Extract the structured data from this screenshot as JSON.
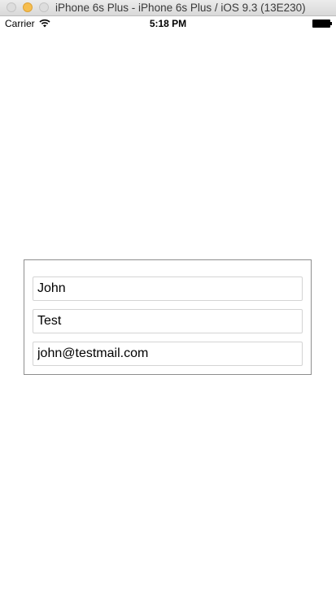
{
  "window": {
    "title": "iPhone 6s Plus - iPhone 6s Plus / iOS 9.3 (13E230)"
  },
  "status_bar": {
    "carrier": "Carrier",
    "time": "5:18 PM",
    "wifi_icon": "wifi-icon",
    "battery_icon": "battery-icon"
  },
  "form": {
    "first_name": "John",
    "last_name": "Test",
    "email": "john@testmail.com"
  }
}
